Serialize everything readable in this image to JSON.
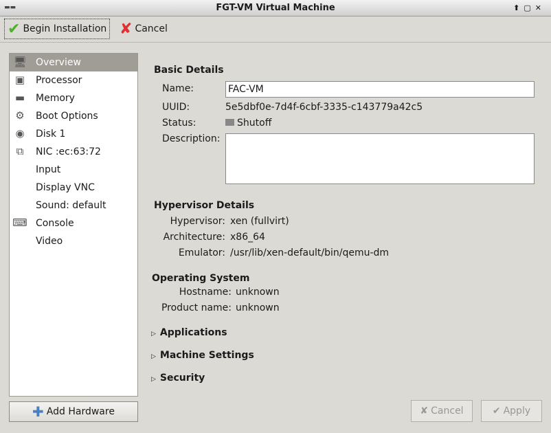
{
  "window": {
    "title": "FGT-VM Virtual Machine",
    "controls": [
      "⬆",
      "▢",
      "✕"
    ]
  },
  "toolbar": {
    "begin": "Begin Installation",
    "cancel": "Cancel"
  },
  "sidebar": {
    "items": [
      {
        "label": "Overview",
        "icon": "monitor-icon",
        "glyph": "🖥"
      },
      {
        "label": "Processor",
        "icon": "cpu-icon",
        "glyph": "▣"
      },
      {
        "label": "Memory",
        "icon": "memory-icon",
        "glyph": "▬"
      },
      {
        "label": "Boot Options",
        "icon": "gears-icon",
        "glyph": "⚙"
      },
      {
        "label": "Disk 1",
        "icon": "disk-icon",
        "glyph": "◉"
      },
      {
        "label": "NIC :ec:63:72",
        "icon": "network-icon",
        "glyph": "⧉"
      },
      {
        "label": "Input",
        "icon": "",
        "glyph": ""
      },
      {
        "label": "Display VNC",
        "icon": "",
        "glyph": ""
      },
      {
        "label": "Sound: default",
        "icon": "",
        "glyph": ""
      },
      {
        "label": "Console",
        "icon": "console-icon",
        "glyph": "⌨"
      },
      {
        "label": "Video",
        "icon": "",
        "glyph": ""
      }
    ],
    "add_hardware": "Add Hardware"
  },
  "basic": {
    "title": "Basic Details",
    "name_label": "Name:",
    "name": "FAC-VM",
    "uuid_label": "UUID:",
    "uuid": "5e5dbf0e-7d4f-6cbf-3335-c143779a42c5",
    "status_label": "Status:",
    "status": "Shutoff",
    "desc_label": "Description:",
    "description": ""
  },
  "hypervisor": {
    "title": "Hypervisor Details",
    "hv_label": "Hypervisor:",
    "hv": "xen (fullvirt)",
    "arch_label": "Architecture:",
    "arch": "x86_64",
    "emu_label": "Emulator:",
    "emu": "/usr/lib/xen-default/bin/qemu-dm"
  },
  "os": {
    "title": "Operating System",
    "host_label": "Hostname:",
    "host": "unknown",
    "prod_label": "Product name:",
    "prod": "unknown"
  },
  "expanders": [
    "Applications",
    "Machine Settings",
    "Security"
  ],
  "buttons": {
    "cancel": "Cancel",
    "apply": "Apply"
  }
}
